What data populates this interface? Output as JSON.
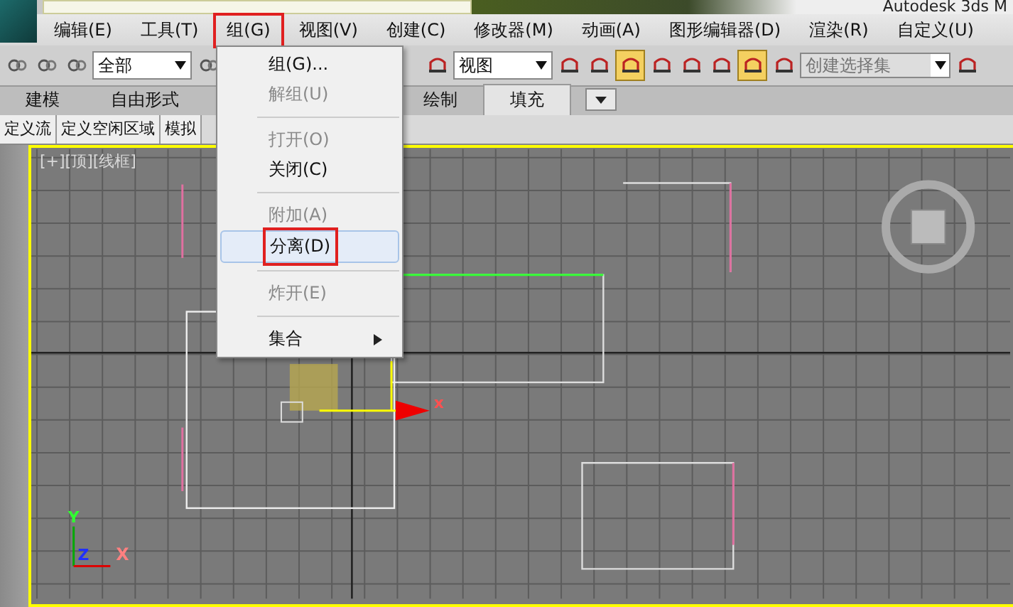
{
  "window": {
    "title": "Autodesk 3ds M"
  },
  "menu_bar": [
    {
      "label": "编辑(E)",
      "selected": false
    },
    {
      "label": "工具(T)",
      "selected": false
    },
    {
      "label": "组(G)",
      "selected": true
    },
    {
      "label": "视图(V)",
      "selected": false
    },
    {
      "label": "创建(C)",
      "selected": false
    },
    {
      "label": "修改器(M)",
      "selected": false
    },
    {
      "label": "动画(A)",
      "selected": false
    },
    {
      "label": "图形编辑器(D)",
      "selected": false
    },
    {
      "label": "渲染(R)",
      "selected": false
    },
    {
      "label": "自定义(U)",
      "selected": false
    }
  ],
  "toolbar": {
    "left": [
      {
        "kind": "icon",
        "selected": false
      },
      {
        "kind": "icon",
        "selected": false
      },
      {
        "kind": "icon",
        "selected": false
      },
      {
        "kind": "dropdown",
        "value": "全部"
      },
      {
        "kind": "icon",
        "selected": false
      }
    ],
    "right": [
      {
        "kind": "icon",
        "selected": false
      },
      {
        "kind": "dropdown",
        "value": "视图"
      },
      {
        "kind": "icon",
        "selected": false
      },
      {
        "kind": "icon",
        "selected": false
      },
      {
        "kind": "icon",
        "selected": true
      },
      {
        "kind": "icon",
        "selected": false
      },
      {
        "kind": "icon",
        "selected": false
      },
      {
        "kind": "icon",
        "selected": false
      },
      {
        "kind": "icon",
        "selected": true
      },
      {
        "kind": "icon",
        "selected": false
      },
      {
        "kind": "field",
        "placeholder": "创建选择集"
      },
      {
        "kind": "icon",
        "selected": false
      }
    ]
  },
  "ribbon": {
    "left_tabs": [
      {
        "label": "建模",
        "selected": false
      },
      {
        "label": "自由形式",
        "selected": false
      }
    ],
    "right_tabs": [
      {
        "label": "绘制",
        "selected": false
      },
      {
        "label": "填充",
        "selected": true
      }
    ],
    "sub_tabs": [
      {
        "label": "定义流"
      },
      {
        "label": "定义空闲区域"
      },
      {
        "label": "模拟"
      }
    ]
  },
  "viewport": {
    "label": "[+][顶][线框]",
    "active": true,
    "gizmo_label": "x",
    "axis_labels": {
      "x": "X",
      "y": "Y",
      "z": "Z"
    }
  },
  "group_menu": {
    "sections": [
      [
        {
          "label": "组(G)...",
          "disabled": false,
          "selected": false,
          "submenu": false
        },
        {
          "label": "解组(U)",
          "disabled": true,
          "selected": false,
          "submenu": false
        }
      ],
      [
        {
          "label": "打开(O)",
          "disabled": true,
          "selected": false,
          "submenu": false
        },
        {
          "label": "关闭(C)",
          "disabled": false,
          "selected": false,
          "submenu": false
        }
      ],
      [
        {
          "label": "附加(A)",
          "disabled": true,
          "selected": false,
          "submenu": false
        },
        {
          "label": "分离(D)",
          "disabled": false,
          "selected": true,
          "submenu": false
        }
      ],
      [
        {
          "label": "炸开(E)",
          "disabled": true,
          "selected": false,
          "submenu": false
        }
      ],
      [
        {
          "label": "集合",
          "disabled": false,
          "selected": false,
          "submenu": true
        }
      ]
    ]
  }
}
